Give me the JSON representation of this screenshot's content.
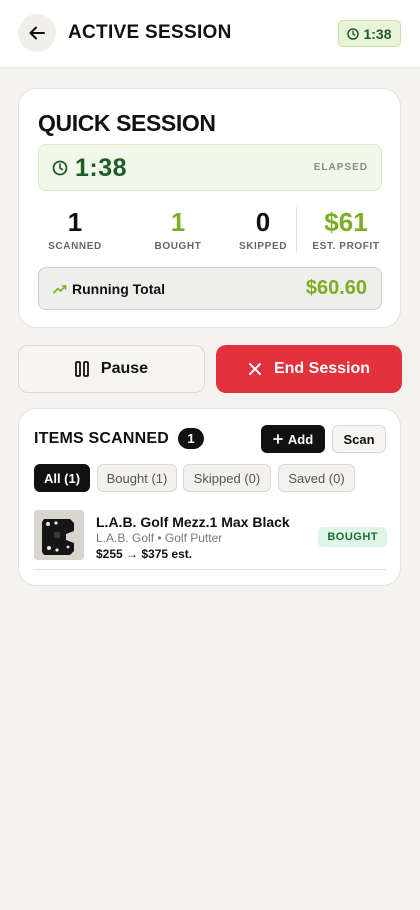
{
  "header": {
    "title": "ACTIVE SESSION",
    "timer": "1:38"
  },
  "session": {
    "title": "QUICK SESSION",
    "elapsed_time": "1:38",
    "elapsed_label": "ELAPSED",
    "stats": [
      {
        "value": "1",
        "label": "SCANNED",
        "color": "#111111"
      },
      {
        "value": "1",
        "label": "BOUGHT",
        "color": "#7cad24"
      },
      {
        "value": "0",
        "label": "SKIPPED",
        "color": "#111111"
      },
      {
        "value": "$61",
        "label": "EST. PROFIT",
        "color": "#7cad24"
      }
    ],
    "running_total_label": "Running Total",
    "running_total_value": "$60.60"
  },
  "actions": {
    "pause_label": "Pause",
    "end_label": "End Session"
  },
  "items": {
    "title": "ITEMS SCANNED",
    "count": "1",
    "add_label": "Add",
    "scan_label": "Scan",
    "filters": [
      {
        "label": "All (1)",
        "active": true
      },
      {
        "label": "Bought (1)",
        "active": false
      },
      {
        "label": "Skipped (0)",
        "active": false
      },
      {
        "label": "Saved (0)",
        "active": false
      }
    ],
    "list": [
      {
        "name": "L.A.B. Golf Mezz.1 Max Black",
        "meta": "L.A.B. Golf • Golf Putter",
        "price": "$255 → $375 est.",
        "status": "BOUGHT"
      }
    ]
  },
  "colors": {
    "accent_green": "#7cad24",
    "dark_green": "#1e5b2a",
    "danger_red": "#e3323c",
    "background": "#f4f3ef"
  }
}
